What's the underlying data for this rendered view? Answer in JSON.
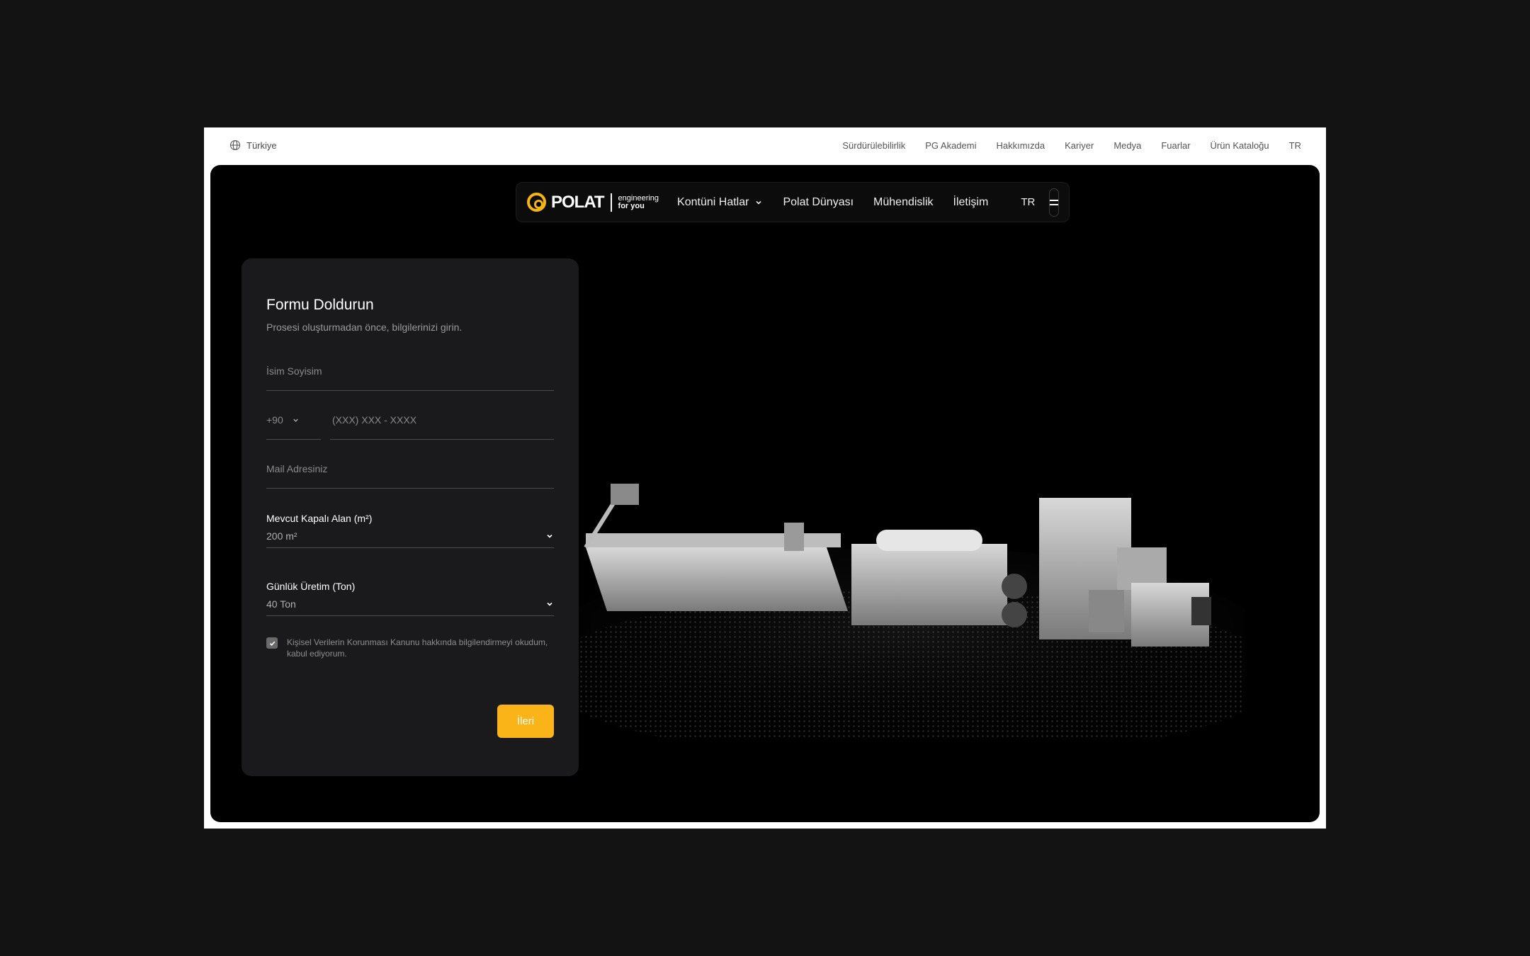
{
  "topbar": {
    "region": "Türkiye",
    "links": [
      "Sürdürülebilirlik",
      "PG Akademi",
      "Hakkımızda",
      "Kariyer",
      "Medya",
      "Fuarlar",
      "Ürün Kataloğu",
      "TR"
    ]
  },
  "nav": {
    "logo_word": "POLAT",
    "logo_tag_1": "engineering",
    "logo_tag_2": "for you",
    "items": [
      "Kontüni Hatlar",
      "Polat Dünyası",
      "Mühendislik",
      "İletişim"
    ],
    "lang": "TR",
    "menu_icon": "menu-icon"
  },
  "form": {
    "title": "Formu Doldurun",
    "subtitle": "Prosesi oluşturmadan önce, bilgilerinizi girin.",
    "name_placeholder": "İsim Soyisim",
    "phone_code": "+90",
    "phone_placeholder": "(XXX) XXX - XXXX",
    "mail_placeholder": "Mail Adresiniz",
    "area_label": "Mevcut Kapalı Alan (m²)",
    "area_value": "200 m²",
    "production_label": "Günlük Üretim (Ton)",
    "production_value": "40 Ton",
    "consent": "Kişisel Verilerin Korunması Kanunu hakkında bilgilendirmeyi okudum, kabul ediyorum.",
    "consent_checked": true,
    "next_label": "İleri"
  },
  "colors": {
    "accent": "#fbb417",
    "hero_bg": "#000000",
    "card_bg": "#1a1a1d"
  }
}
